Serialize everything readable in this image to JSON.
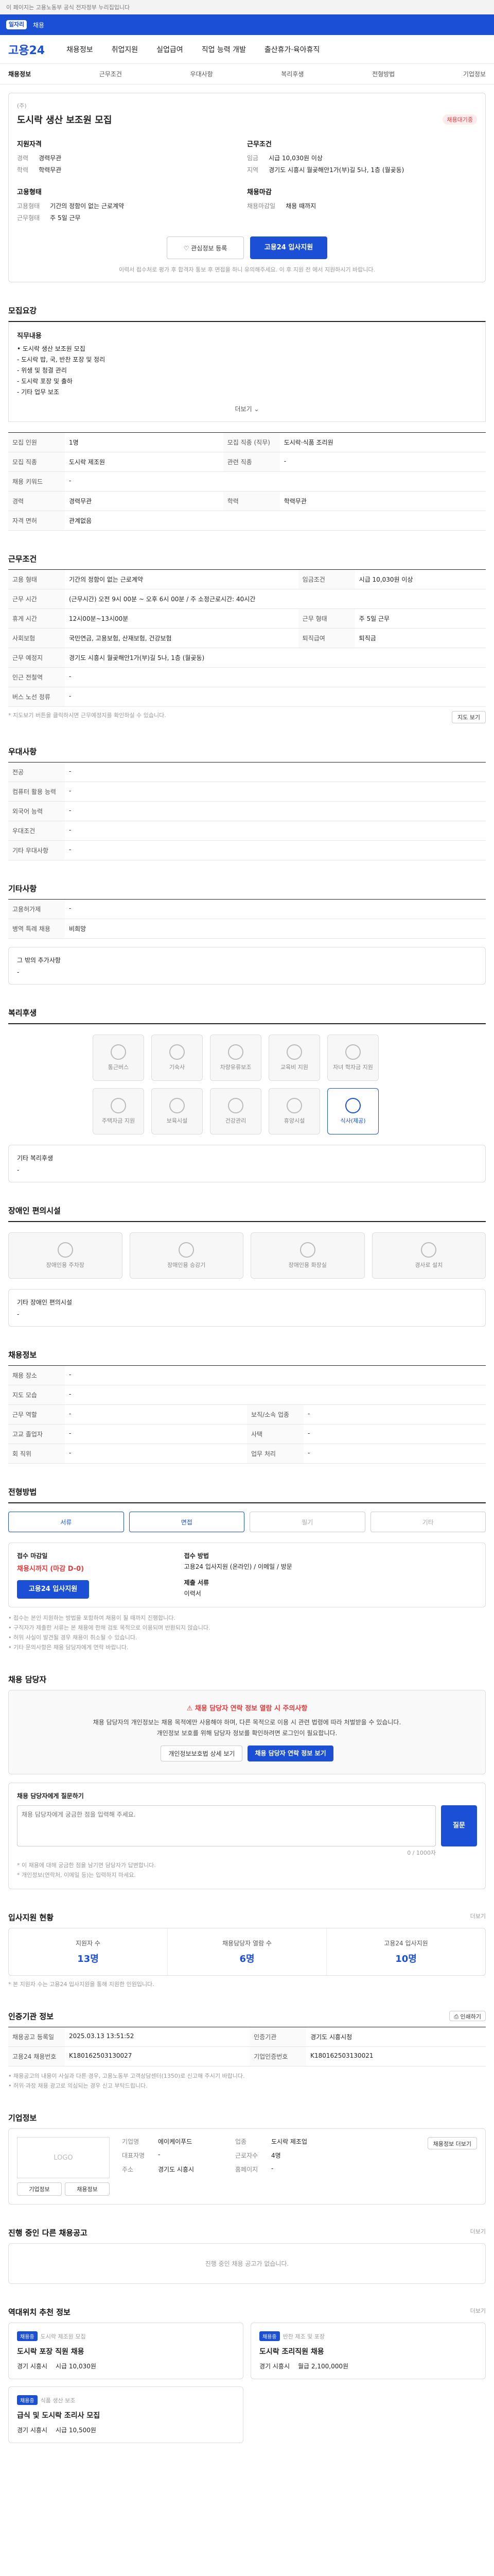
{
  "notice_bar": {
    "text": "이 페이지는 고용노동부 공식 전자정부 누리집입니다"
  },
  "brand_bar": {
    "logo": "일자리",
    "text": "채용"
  },
  "gnb": {
    "logo": "고용24",
    "menu": [
      "채용정보",
      "취업지원",
      "실업급여",
      "직업 능력 개발",
      "출산휴가·육아휴직"
    ]
  },
  "subnav": {
    "items": [
      "채용정보",
      "근무조건",
      "우대사항",
      "복리후생",
      "전형방법",
      "기업정보"
    ],
    "active_index": 0
  },
  "summary": {
    "company": "(주)",
    "title": "도시락 생산 보조원 모집",
    "status": "채용대기중",
    "recruit_label": "지원자격",
    "career_k": "경력",
    "career_v": "경력무관",
    "edu_k": "학력",
    "edu_v": "학력무관",
    "cond_label": "근무조건",
    "pay_k": "임금",
    "pay_v": "시급 10,030원 이상",
    "loc_k": "지역",
    "loc_v": "경기도 시흥시 월곶해안1가(부)길 5나, 1층 (월곶동)",
    "type_label": "고용형태",
    "type_k": "고용형태",
    "type_v": "기간의 정함이 없는 근로계약",
    "hours_k": "근무형태",
    "hours_v": "주 5일 근무",
    "deadline_label": "채용마감",
    "deadline_k": "채용마감일",
    "deadline_v": "채용 때까지",
    "scrap_button": "관심정보 등록",
    "apply_button": "고용24 입사지원",
    "notice": "이력서 접수처로 평가 후 합격자 통보 후 면접을 하니 유의해주세요. 이 후 지원 전 에서 지원하시기 바랍니다."
  },
  "recruit": {
    "title": "모집요강",
    "duty_title": "직무내용",
    "duty_lines": [
      "• 도시락 생산 보조원 모집",
      "- 도시락 밥, 국, 반찬 포장 및 정리",
      "- 위생 및 청결 관리",
      "- 도시락 포장 및 출하",
      "- 기타 업무 보조"
    ],
    "more": "더보기",
    "rows": [
      {
        "k": "모집 인원",
        "v": "1명",
        "k2": "모집 직종 (직무)",
        "v2": "도시락·식품 조리원"
      },
      {
        "k": "모집 직종",
        "v": "도시락 제조원",
        "k2": "관련 직종",
        "v2": "-"
      },
      {
        "k": "채용 키워드",
        "v": "-",
        "k2": "",
        "v2": ""
      },
      {
        "k": "경력",
        "v": "경력무관",
        "k2": "학력",
        "v2": "학력무관"
      },
      {
        "k": "자격 면허",
        "v": "관계없음",
        "k2": "",
        "v2": ""
      }
    ]
  },
  "work": {
    "title": "근무조건",
    "rows": [
      {
        "k": "고용 형태",
        "v": "기간의 정함이 없는 근로계약",
        "k2": "임금조건",
        "v2": "시급 10,030원 이상"
      },
      {
        "k": "근무 시간",
        "v": "(근무시간) 오전 9시 00분 ~ 오후 6시 00분 / 주 소정근로시간: 40시간",
        "k2": "",
        "v2": ""
      },
      {
        "k": "휴게 시간",
        "v": "12시00분~13시00분",
        "k2": "근무 형태",
        "v2": "주 5일 근무"
      },
      {
        "k": "사회보험",
        "v": "국민연금, 고용보험, 산재보험, 건강보험",
        "k2": "퇴직급여",
        "v2": "퇴직금"
      },
      {
        "k": "근무 예정지",
        "v": "경기도 시흥시 월곶해안1가(부)길 5나, 1층 (월곶동)",
        "k2": "",
        "v2": ""
      },
      {
        "k": "인근 전철역",
        "v": "-",
        "k2": "",
        "v2": ""
      },
      {
        "k": "버스 노선 정류",
        "v": "-",
        "k2": "",
        "v2": ""
      }
    ],
    "map_button": "지도 보기",
    "footnote": "* 지도보기 버튼을 클릭하시면 근무예정지를 확인하실 수 있습니다."
  },
  "prefer": {
    "title": "우대사항",
    "rows": [
      {
        "k": "전공",
        "v": "-"
      },
      {
        "k": "컴퓨터 활용 능력",
        "v": "-"
      },
      {
        "k": "외국어 능력",
        "v": "-"
      },
      {
        "k": "우대조건",
        "v": "-"
      },
      {
        "k": "기타 우대사항",
        "v": "-"
      }
    ]
  },
  "other": {
    "title": "기타사항",
    "rows": [
      {
        "k": "고용허가제",
        "v": "-"
      },
      {
        "k": "병역 특례 채용",
        "v": "비희망"
      }
    ],
    "sub_title": "그 밖의 추가사항",
    "sub_val": "-"
  },
  "welfare": {
    "title": "복리후생",
    "tiles": [
      "통근버스",
      "기숙사",
      "차량유류보조",
      "교육비 지원",
      "자녀 학자금 지원",
      "주택자금 지원",
      "보육시설",
      "건강관리",
      "휴양시설",
      "식사(제공)"
    ],
    "selected_index": 9,
    "extra_title": "기타 복리후생",
    "extra_val": "-"
  },
  "disability": {
    "title": "장애인 편의시설",
    "tiles": [
      "장애인용 주차장",
      "장애인용 승강기",
      "장애인용 화장실",
      "경사로 설치"
    ],
    "extra_title": "기타 장애인 편의시설",
    "extra_val": "-"
  },
  "position": {
    "title": "채용정보",
    "rows": [
      {
        "k": "채용 장소",
        "v": "-",
        "k2": "",
        "v2": ""
      },
      {
        "k": "지도 모습",
        "v": "-",
        "k2": "",
        "v2": ""
      },
      {
        "k": "근무 역할",
        "v": "-",
        "k2": "보직/소속 업종",
        "v2": "-"
      },
      {
        "k": "고교 졸업자",
        "v": "-",
        "k2": "사택",
        "v2": "-"
      },
      {
        "k": "회 직위",
        "v": "-",
        "k2": "업무 처리",
        "v2": "-"
      }
    ]
  },
  "selection": {
    "title": "전형방법",
    "steps": [
      "서류",
      "면접",
      "필기",
      "기타"
    ],
    "apply_title": "접수 마감일",
    "apply_type_k": "접수 방법",
    "apply_type_v": "고용24 입사지원 (온라인) / 이메일 / 방문",
    "submit_k": "제출 서류",
    "submit_v": "이력서",
    "deadline_v": "채용시까지 (마감 D-0)",
    "apply_button": "고용24 입사지원",
    "notes": [
      "• 접수는 본인 지원하는 방법을 포함하여 채용이 될 때까지 진행합니다.",
      "• 구직자가 제출한 서류는 본 채용에 한해 검토 목적으로 이용되며 반환되지 않습니다.",
      "• 허위 사실이 발견될 경우 채용이 취소될 수 있습니다.",
      "• 기타 문의사항은 채용 담당자에게 연락 바랍니다."
    ]
  },
  "contact": {
    "title": "채용 담당자",
    "warn": "채용 담당자 연락 정보 열람 시 주의사항",
    "desc": "채용 담당자의 개인정보는 채용 목적에만 사용해야 하며, 다른 목적으로 이용 시 관련 법령에 따라 처벌받을 수 있습니다.",
    "desc2": "개인정보 보호를 위해 담당자 정보를 확인하려면 로그인이 필요합니다.",
    "btn1": "개인정보보호법 상세 보기",
    "btn2": "채용 담당자 연락 정보 보기",
    "qa_title": "채용 담당자에게 질문하기",
    "qa_hint": "0 / 1000자",
    "qa_placeholder": "채용 담당자에게 궁금한 점을 입력해 주세요.",
    "qa_button": "질문",
    "qa_notes": [
      "* 이 채용에 대해 궁금한 점을 남기면 담당자가 답변합니다.",
      "* 개인정보(연락처, 이메일 등)는 입력하지 마세요."
    ]
  },
  "stats": {
    "title": "입사지원 현황",
    "more": "더보기",
    "items": [
      {
        "k": "지원자 수",
        "v": "13명"
      },
      {
        "k": "채용담당자 열람 수",
        "v": "6명"
      },
      {
        "k": "고용24 입사지원",
        "v": "10명"
      }
    ],
    "note": "* 본 지원자 수는 고용24 입사지원을 통해 지원한 인원입니다."
  },
  "manager": {
    "title": "인증기관 정보",
    "print": "인쇄하기",
    "rows": [
      {
        "k": "채용공고 등록일",
        "v": "2025.03.13 13:51:52",
        "k2": "인증기관",
        "v2": "경기도 시흥시청"
      },
      {
        "k": "고용24 채용번호",
        "v": "K180162503130027",
        "k2": "기업인증번호",
        "v2": "K180162503130021"
      }
    ],
    "notes": [
      "• 채용공고의 내용이 사실과 다른 경우, 고용노동부 고객상담센터(1350)로 신고해 주시기 바랍니다.",
      "• 허위·과장 채용 광고로 의심되는 경우 신고 부탁드립니다."
    ]
  },
  "company": {
    "title": "기업정보",
    "logo_text": "LOGO",
    "btn1": "기업정보",
    "btn2": "채용정보",
    "rows": [
      {
        "k": "기업명",
        "v": "에이케이푸드",
        "k2": "업종",
        "v2": "도시락 제조업"
      },
      {
        "k": "대표자명",
        "v": "-",
        "k2": "근로자수",
        "v2": "4명"
      },
      {
        "k": "주소",
        "v": "경기도 시흥시",
        "k2": "홈페이지",
        "v2": "-"
      }
    ],
    "more_button": "채용정보 더보기"
  },
  "other_jobs": {
    "title": "진행 중인 다른 채용공고",
    "more": "더보기",
    "empty": "진행 중인 채용 공고가 없습니다."
  },
  "recommend": {
    "title": "역대위치 추천 정보",
    "more": "더보기",
    "cards": [
      {
        "tag": "채용중",
        "sub": "도시락 제조원 모집",
        "title": "도시락 포장 직원 채용",
        "loc": "경기 시흥시",
        "pay": "시급 10,030원"
      },
      {
        "tag": "채용중",
        "sub": "반찬 제조 및 포장",
        "title": "도시락 조리직원 채용",
        "loc": "경기 시흥시",
        "pay": "월급 2,100,000원"
      },
      {
        "tag": "채용중",
        "sub": "식품 생산 보조",
        "title": "급식 및 도시락 조리사 모집",
        "loc": "경기 시흥시",
        "pay": "시급 10,500원"
      }
    ]
  }
}
